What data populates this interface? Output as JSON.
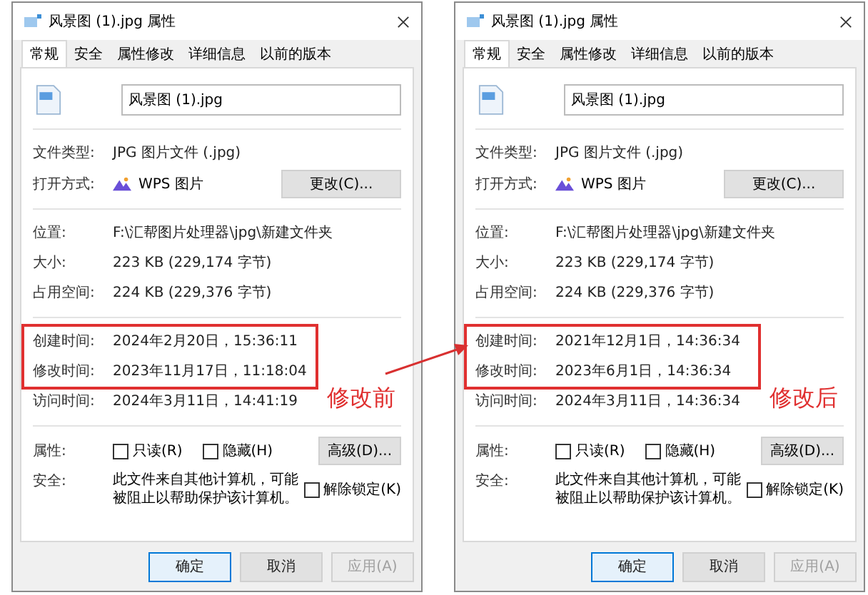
{
  "dialogs": [
    {
      "title": "风景图 (1).jpg 属性",
      "tabs": [
        {
          "label": "常规",
          "selected": true
        },
        {
          "label": "安全",
          "selected": false
        },
        {
          "label": "属性修改",
          "selected": false
        },
        {
          "label": "详细信息",
          "selected": false
        },
        {
          "label": "以前的版本",
          "selected": false
        }
      ],
      "file_name": "风景图 (1).jpg",
      "file_type_label": "文件类型:",
      "file_type": "JPG 图片文件 (.jpg)",
      "open_with_label": "打开方式:",
      "open_with": "WPS 图片",
      "change_button": "更改(C)...",
      "location_label": "位置:",
      "location": "F:\\汇帮图片处理器\\jpg\\新建文件夹",
      "size_label": "大小:",
      "size": "223 KB (229,174 字节)",
      "disk_label": "占用空间:",
      "disk": "224 KB (229,376 字节)",
      "times": [
        {
          "label": "创建时间:",
          "value": "2024年2月20日，15:36:11",
          "highlighted": true
        },
        {
          "label": "修改时间:",
          "value": "2023年11月17日，11:18:04",
          "highlighted": true
        },
        {
          "label": "访问时间:",
          "value": "2024年3月11日，14:41:19",
          "highlighted": false
        }
      ],
      "attributes_label": "属性:",
      "checkboxes": [
        {
          "label": "只读(R)",
          "checked": false
        },
        {
          "label": "隐藏(H)",
          "checked": false
        }
      ],
      "advanced_button": "高级(D)...",
      "security_label": "安全:",
      "security_text": "此文件来自其他计算机，可能被阻止以帮助保护该计算机。",
      "unblock": {
        "label": "解除锁定(K)",
        "checked": false
      },
      "buttons": [
        {
          "label": "确定",
          "default": true,
          "disabled": false
        },
        {
          "label": "取消",
          "default": false,
          "disabled": false
        },
        {
          "label": "应用(A)",
          "default": false,
          "disabled": true
        }
      ],
      "annotation": "修改前"
    },
    {
      "title": "风景图 (1).jpg 属性",
      "tabs": [
        {
          "label": "常规",
          "selected": true
        },
        {
          "label": "安全",
          "selected": false
        },
        {
          "label": "属性修改",
          "selected": false
        },
        {
          "label": "详细信息",
          "selected": false
        },
        {
          "label": "以前的版本",
          "selected": false
        }
      ],
      "file_name": "风景图 (1).jpg",
      "file_type_label": "文件类型:",
      "file_type": "JPG 图片文件 (.jpg)",
      "open_with_label": "打开方式:",
      "open_with": "WPS 图片",
      "change_button": "更改(C)...",
      "location_label": "位置:",
      "location": "F:\\汇帮图片处理器\\jpg\\新建文件夹",
      "size_label": "大小:",
      "size": "223 KB (229,174 字节)",
      "disk_label": "占用空间:",
      "disk": "224 KB (229,376 字节)",
      "times": [
        {
          "label": "创建时间:",
          "value": "2021年12月1日，14:36:34",
          "highlighted": true
        },
        {
          "label": "修改时间:",
          "value": "2023年6月1日，14:36:34",
          "highlighted": true
        },
        {
          "label": "访问时间:",
          "value": "2024年3月11日，14:36:34",
          "highlighted": false
        }
      ],
      "attributes_label": "属性:",
      "checkboxes": [
        {
          "label": "只读(R)",
          "checked": false
        },
        {
          "label": "隐藏(H)",
          "checked": false
        }
      ],
      "advanced_button": "高级(D)...",
      "security_label": "安全:",
      "security_text": "此文件来自其他计算机，可能被阻止以帮助保护该计算机。",
      "unblock": {
        "label": "解除锁定(K)",
        "checked": false
      },
      "buttons": [
        {
          "label": "确定",
          "default": true,
          "disabled": false
        },
        {
          "label": "取消",
          "default": false,
          "disabled": false
        },
        {
          "label": "应用(A)",
          "default": false,
          "disabled": true
        }
      ],
      "annotation": "修改后"
    }
  ]
}
